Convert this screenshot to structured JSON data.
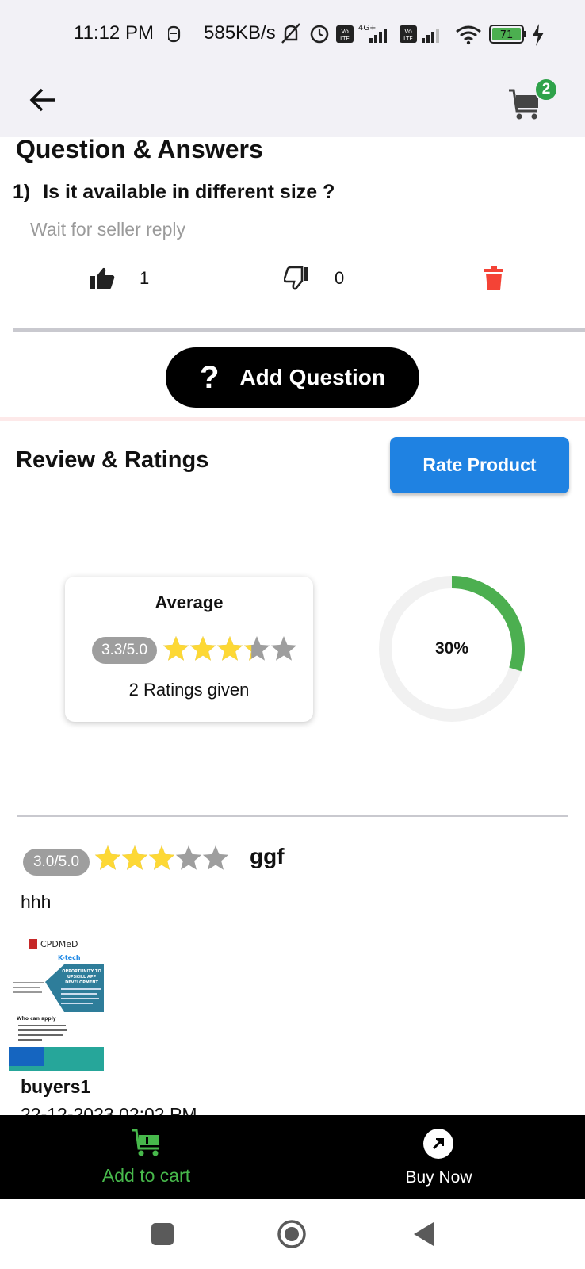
{
  "status_bar": {
    "time": "11:12 PM",
    "network_speed": "585KB/s",
    "battery": "71"
  },
  "app_bar": {
    "cart_count": "2"
  },
  "qa": {
    "title": "Question & Answers",
    "question_number": "1)",
    "question_text": "Is it available in different size ?",
    "reply_text": "Wait for seller reply",
    "likes": "1",
    "dislikes": "0",
    "add_question_icon": "?",
    "add_question_label": "Add Question"
  },
  "reviews": {
    "title": "Review & Ratings",
    "rate_button_label": "Rate Product",
    "average": {
      "title": "Average",
      "score_text": "3.3/5.0",
      "rating": 3.3,
      "ratings_given": "2 Ratings given"
    },
    "percent": {
      "label": "30%",
      "value": 0.3
    },
    "items": [
      {
        "score_text": "3.0/5.0",
        "rating": 3.0,
        "name": "ggf",
        "text": "hhh",
        "image_text": {
          "brand": "CPDMeD",
          "brand_sub": "K-tech",
          "headline": "OPPORTUNITY TO UPSKILL APP DEVELOPMENT",
          "who_can_apply": "Who can apply"
        },
        "user": "buyers1",
        "date": "22-12-2023 02:02 PM"
      }
    ]
  },
  "bottom_bar": {
    "add_to_cart_label": "Add to cart",
    "buy_now_label": "Buy Now"
  },
  "colors": {
    "accent_blue": "#1f82e2",
    "green": "#47b84b",
    "delete_red": "#f44336",
    "star_yellow": "#fdd835",
    "star_grey": "#9e9e9e"
  }
}
